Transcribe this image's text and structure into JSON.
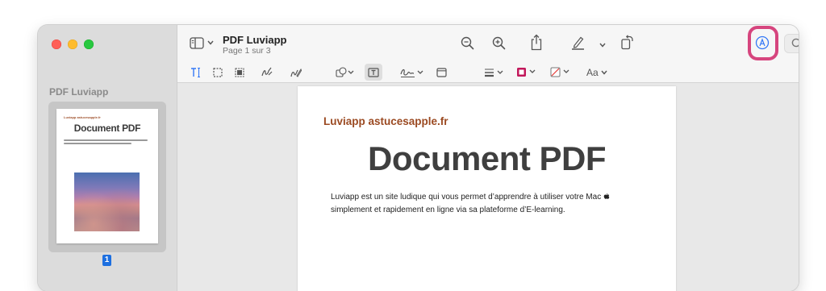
{
  "window": {
    "title": "PDF Luviapp",
    "subtitle": "Page 1 sur 3"
  },
  "sidebar": {
    "title": "PDF Luviapp",
    "page_number": "1",
    "thumbnail": {
      "brand": "Luviapp astucesapple.fr",
      "title": "Document PDF"
    }
  },
  "search": {
    "placeholder": "Rechercher"
  },
  "markup_toolbar": {
    "text_style_label": "Aa"
  },
  "document": {
    "brand": "Luviapp astucesapple.fr",
    "title": "Document PDF",
    "body_line1": "Luviapp est un site ludique qui vous permet d’apprendre à utiliser votre Mac ",
    "body_line2": "simplement et rapidement en ligne via sa plateforme d’E-learning."
  },
  "colors": {
    "highlight": "#d6457e",
    "accent": "#1d6fe0",
    "brand": "#9b4a22"
  }
}
